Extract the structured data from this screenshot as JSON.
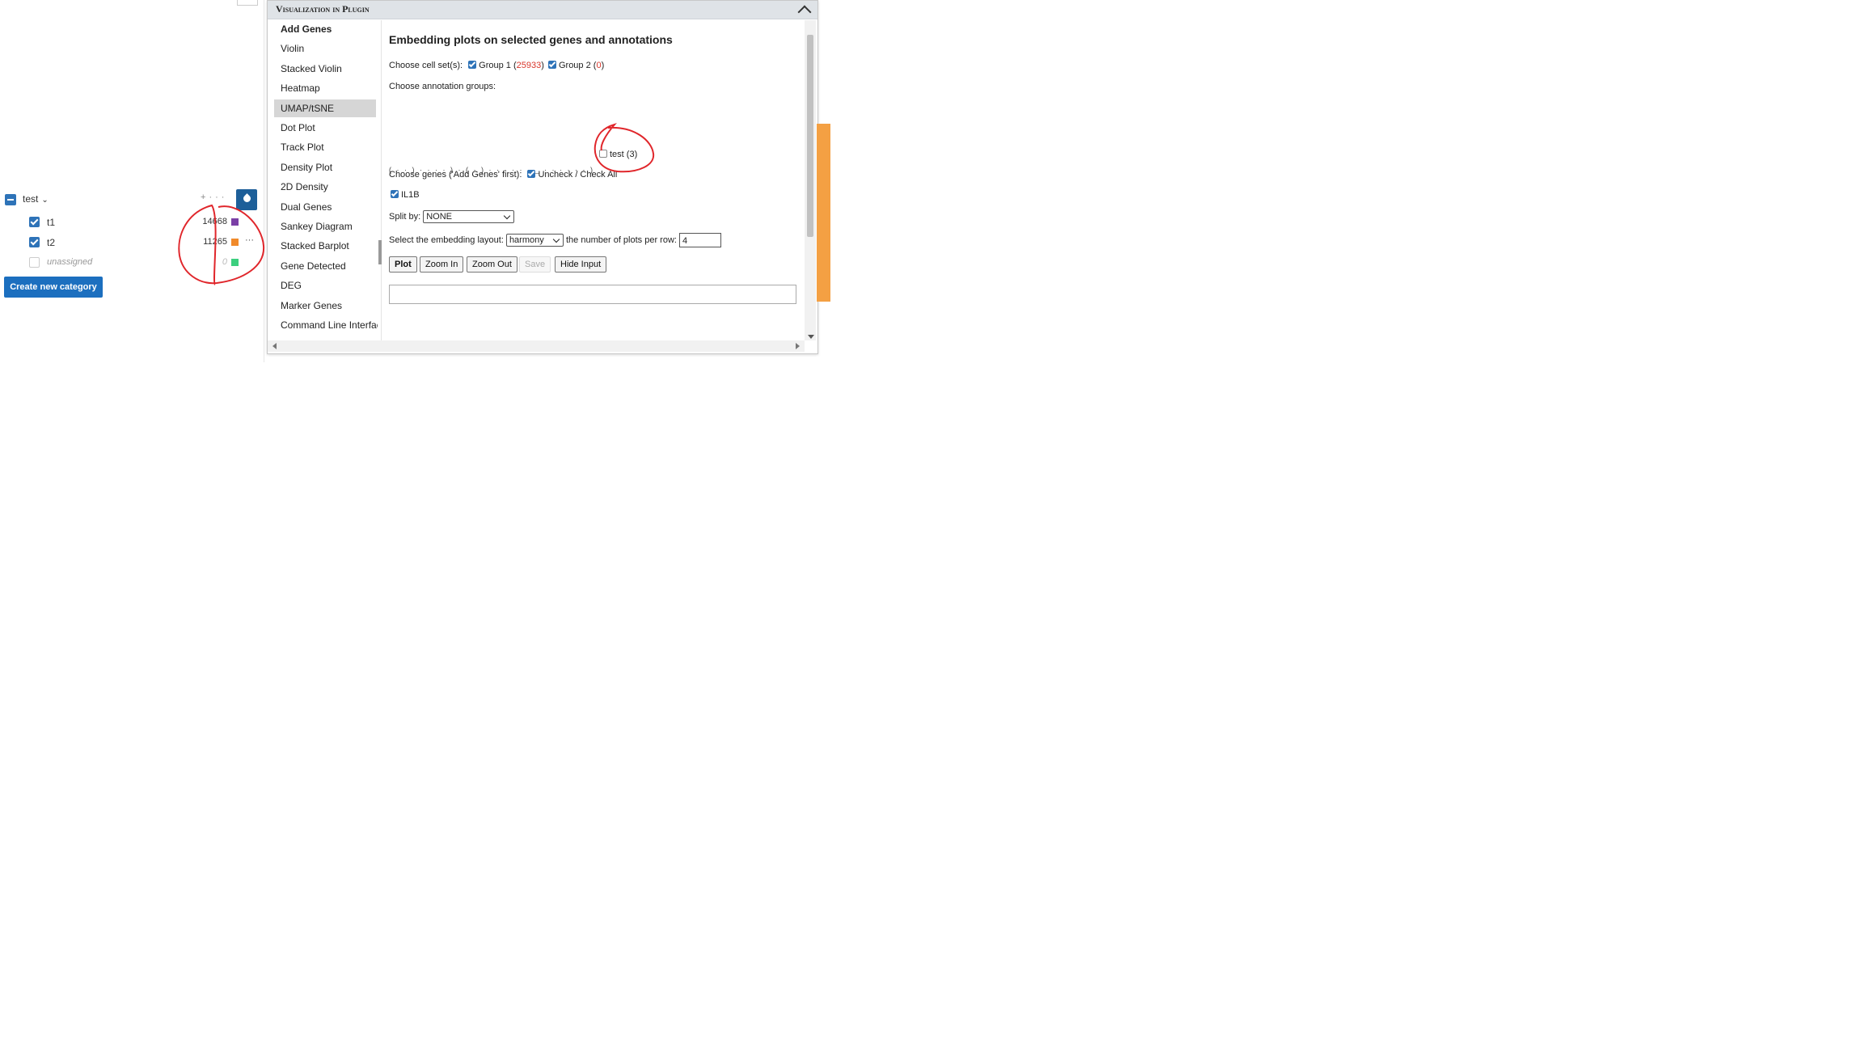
{
  "cellsets": {
    "category_name": "test",
    "items": [
      {
        "label": "t1",
        "count": "14668",
        "color": "#7b3fa6",
        "checked": true
      },
      {
        "label": "t2",
        "count": "11265",
        "color": "#f08a2b",
        "checked": true
      },
      {
        "label": "unassigned",
        "count": "0",
        "color": "#3ccf7e",
        "checked": false
      }
    ],
    "tool_add": "+",
    "tool_more": "···",
    "item_more": "···",
    "create_button": "Create new category"
  },
  "plugin": {
    "window_title": "Visualization in Plugin",
    "menu": [
      "Add Genes",
      "Violin",
      "Stacked Violin",
      "Heatmap",
      "UMAP/tSNE",
      "Dot Plot",
      "Track Plot",
      "Density Plot",
      "2D Density",
      "Dual Genes",
      "Sankey Diagram",
      "Stacked Barplot",
      "Gene Detected",
      "DEG",
      "Marker Genes",
      "Command Line Interface"
    ],
    "active_menu": "UMAP/tSNE",
    "content": {
      "title": "Embedding plots on selected genes and annotations",
      "cellset_label": "Choose cell set(s):",
      "group1_label": "Group 1",
      "group1_count": "25933",
      "group2_label": "Group 2",
      "group2_count": "0",
      "annotation_label": "Choose annotation groups:",
      "annotation_fragment": "( ·   ·   )   ·   ·   ·   ·   )   ·   ( ·   )   ·   ·   ·   ·   ·   ·   _   ·   ·   ·   ·   ·   ·   )",
      "annotation_test": "test (3)",
      "genes_label": "Choose genes ('Add Genes' first):",
      "uncheck_all": "Uncheck / Check All",
      "gene": "IL1B",
      "split_label": "Split by:",
      "split_value": "NONE",
      "layout_label": "Select the embedding layout:",
      "layout_value": "harmony",
      "per_row_label": "the number of plots per row:",
      "per_row_value": "4",
      "buttons": {
        "plot": "Plot",
        "zoom_in": "Zoom In",
        "zoom_out": "Zoom Out",
        "save": "Save",
        "hide_input": "Hide Input"
      }
    }
  },
  "annotation_color": "#e0262b"
}
